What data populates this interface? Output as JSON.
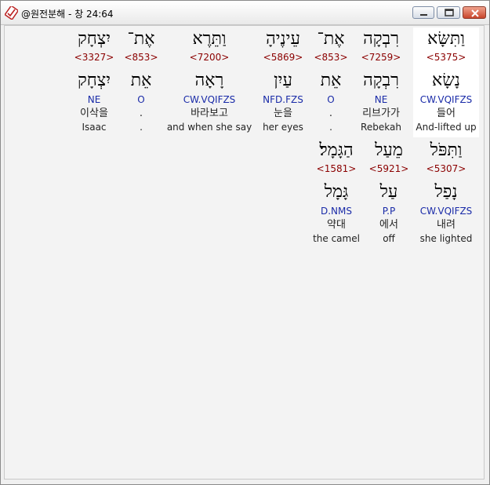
{
  "window": {
    "title": "@원전분해 - 창 24:64",
    "icon": "document-check-icon"
  },
  "lines": [
    {
      "words": [
        {
          "hebrew": "וַתִּשָּׂא",
          "strong": "<5375>",
          "lemma": "נָשָׂא",
          "parse": "CW.VQIFZS",
          "korean": "들어",
          "english": "And-lifted up",
          "highlighted": true
        },
        {
          "hebrew": "רִבְקָה",
          "strong": "<7259>",
          "lemma": "רִבְקָה",
          "parse": "NE",
          "korean": "리브가가",
          "english": "Rebekah"
        },
        {
          "hebrew": "אֶת־",
          "strong": "<853>",
          "lemma": "אֵת",
          "parse": "O",
          "korean": ".",
          "english": "."
        },
        {
          "hebrew": "עֵינֶיהָ",
          "strong": "<5869>",
          "lemma": "עַיִן",
          "parse": "NFD.FZS",
          "korean": "눈을",
          "english": "her eyes"
        },
        {
          "hebrew": "וַתֵּרֶא",
          "strong": "<7200>",
          "lemma": "רָאָה",
          "parse": "CW.VQIFZS",
          "korean": "바라보고",
          "english": "and when she say"
        },
        {
          "hebrew": "אֶת־",
          "strong": "<853>",
          "lemma": "אֵת",
          "parse": "O",
          "korean": ".",
          "english": "."
        },
        {
          "hebrew": "יִצְחָק",
          "strong": "<3327>",
          "lemma": "יִצְחָק",
          "parse": "NE",
          "korean": "이삭을",
          "english": "Isaac"
        }
      ]
    },
    {
      "words": [
        {
          "hebrew": "וַתִּפֹּל",
          "strong": "<5307>",
          "lemma": "נָפַל",
          "parse": "CW.VQIFZS",
          "korean": "내려",
          "english": "she lighted"
        },
        {
          "hebrew": "מֵעַל",
          "strong": "<5921>",
          "lemma": "עַל",
          "parse": "P.P",
          "korean": "에서",
          "english": "off"
        },
        {
          "hebrew": "הַגָּמָל׃",
          "strong": "<1581>",
          "lemma": "גָּמָל",
          "parse": "D.NMS",
          "korean": "약대",
          "english": "the camel"
        }
      ]
    }
  ],
  "colors": {
    "strong": "#8b0000",
    "parse": "#1a2ba8",
    "highlight": "#ffffff",
    "background": "#f3f3f3"
  }
}
